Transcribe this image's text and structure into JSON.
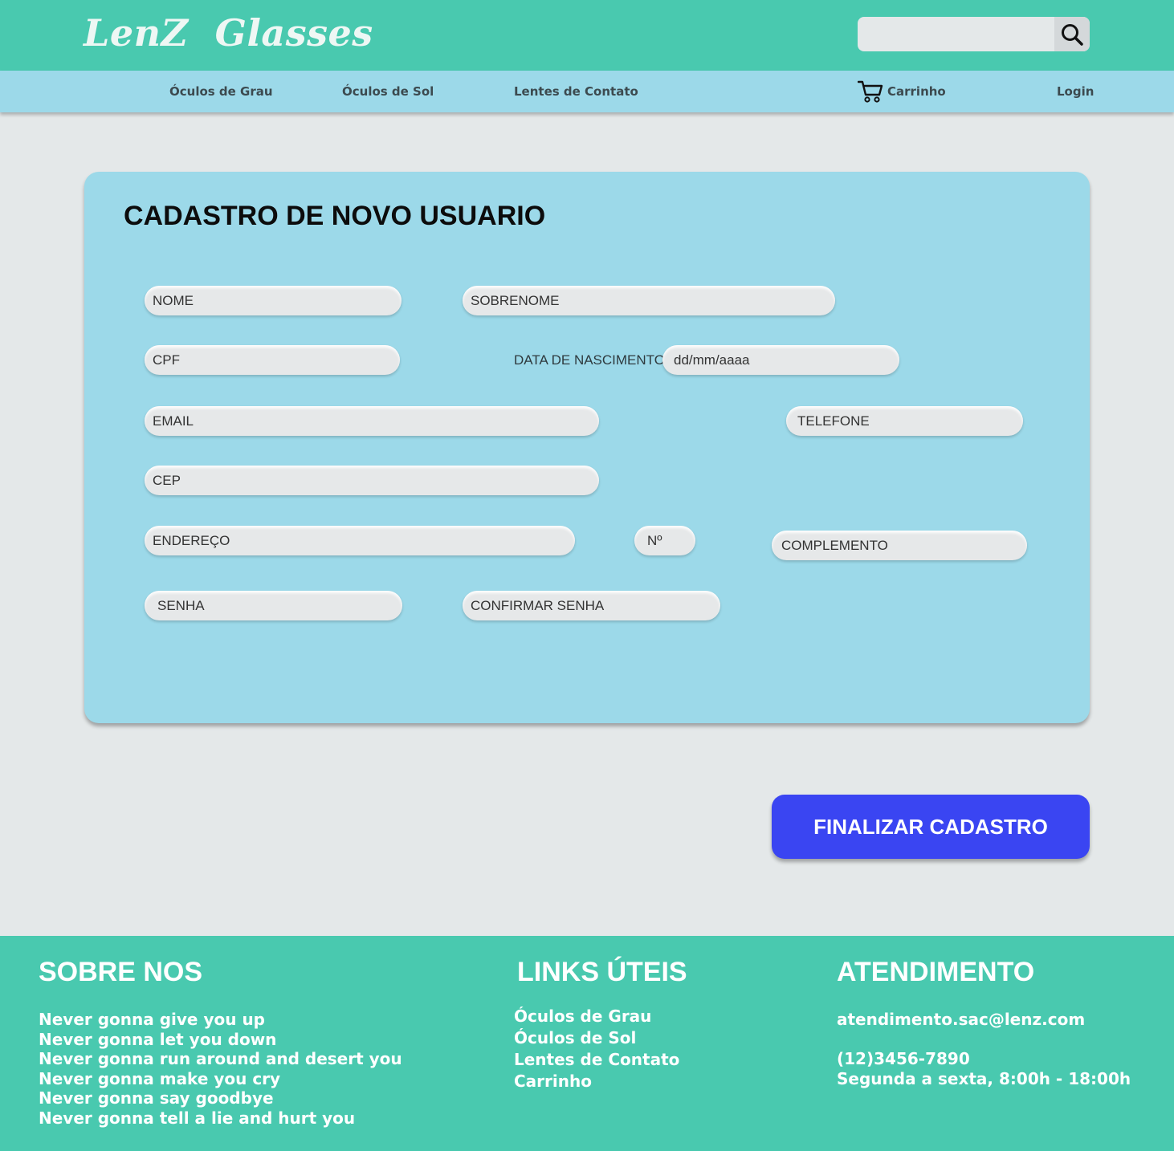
{
  "header": {
    "logo": "LenZ  Glasses",
    "search": {
      "placeholder": "",
      "value": ""
    }
  },
  "nav": {
    "items": [
      {
        "label": "Óculos de Grau"
      },
      {
        "label": "Óculos de Sol"
      },
      {
        "label": "Lentes de Contato"
      },
      {
        "label": "Carrinho"
      },
      {
        "label": "Login"
      }
    ]
  },
  "form": {
    "title": "CADASTRO DE NOVO USUARIO",
    "fields": {
      "nome": "NOME",
      "sobrenome": "SOBRENOME",
      "cpf": "CPF",
      "dob_label": "DATA DE NASCIMENTO",
      "dob": "dd/mm/aaaa",
      "email": "EMAIL",
      "telefone": "TELEFONE",
      "cep": "CEP",
      "endereco": "ENDEREÇO",
      "numero": "Nº",
      "complemento": "COMPLEMENTO",
      "senha": "SENHA",
      "confirmar_senha": "CONFIRMAR SENHA"
    },
    "submit_label": "FINALIZAR CADASTRO"
  },
  "footer": {
    "about": {
      "title": "SOBRE NOS",
      "lines": [
        "Never gonna give you up",
        "Never gonna let you down",
        "Never gonna run around and desert you",
        "Never gonna make you cry",
        "Never gonna say goodbye",
        "Never gonna tell a lie and hurt you"
      ]
    },
    "links": {
      "title": "LINKS ÚTEIS",
      "items": [
        "Óculos de Grau",
        "Óculos de Sol",
        "Lentes de Contato",
        "Carrinho"
      ]
    },
    "contact": {
      "title": "ATENDIMENTO",
      "email": "atendimento.sac@lenz.com",
      "phone": "(12)3456-7890",
      "hours": "Segunda a sexta, 8:00h - 18:00h"
    }
  },
  "colors": {
    "header_bg": "#49c9af",
    "nav_bg": "#9cd9e9",
    "card_bg": "#9cd9e9",
    "page_bg": "#e4e8e9",
    "button_bg": "#3a45f2"
  },
  "icons": {
    "search": "search-icon",
    "cart": "cart-icon"
  }
}
